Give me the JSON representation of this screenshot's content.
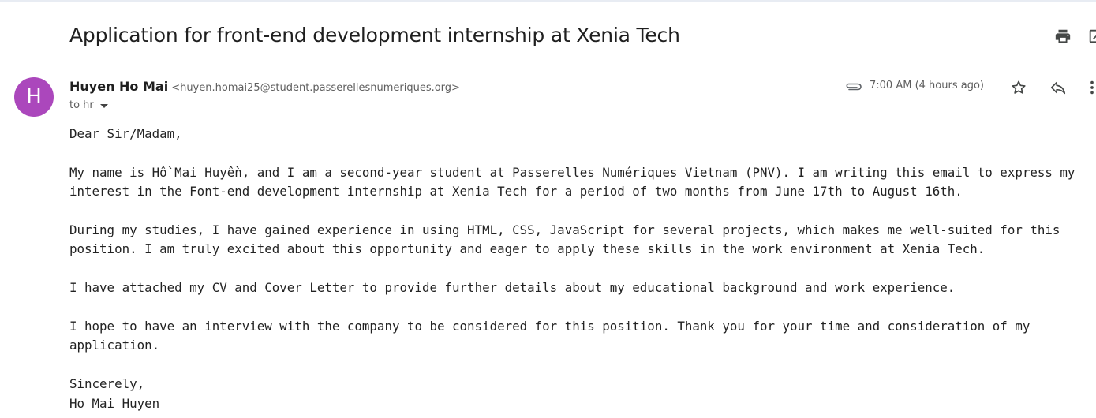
{
  "email": {
    "subject": "Application for front-end development internship at Xenia Tech",
    "sender": {
      "name": "Huyen Ho Mai",
      "email": "<huyen.homai25@student.passerellesnumeriques.org>",
      "avatar_letter": "H",
      "avatar_color": "#ab47bc"
    },
    "recipient_line": "to hr",
    "timestamp": "7:00 AM (4 hours ago)",
    "body": {
      "greeting": "Dear Sir/Madam,",
      "paragraph_1": "My name is Hồ Mai Huyền, and I am a second-year student at Passerelles Numériques Vietnam (PNV). I am writing this email to express my interest in the Font-end development internship at Xenia Tech for a period of two months from June 17th to August 16th.",
      "paragraph_2": "During my studies, I have gained experience in using HTML, CSS, JavaScript for several projects, which makes me well-suited for this position. I am truly excited about this opportunity and eager to apply these skills in the work environment at Xenia Tech.",
      "paragraph_3": "I have attached my CV and Cover Letter to provide further details about my educational background and work experience.",
      "paragraph_4": "I hope to have an interview with the company to be considered for this position. Thank you for your time and consideration of my application.",
      "closing": "Sincerely,",
      "signature": "Ho Mai Huyen"
    }
  },
  "icons": {
    "print": "print-icon",
    "new_window": "open-in-new-window-icon",
    "attachment": "paperclip-icon",
    "star": "star-icon",
    "reply": "reply-icon",
    "more": "more-vert-icon",
    "recipient_details": "chevron-down-icon"
  }
}
